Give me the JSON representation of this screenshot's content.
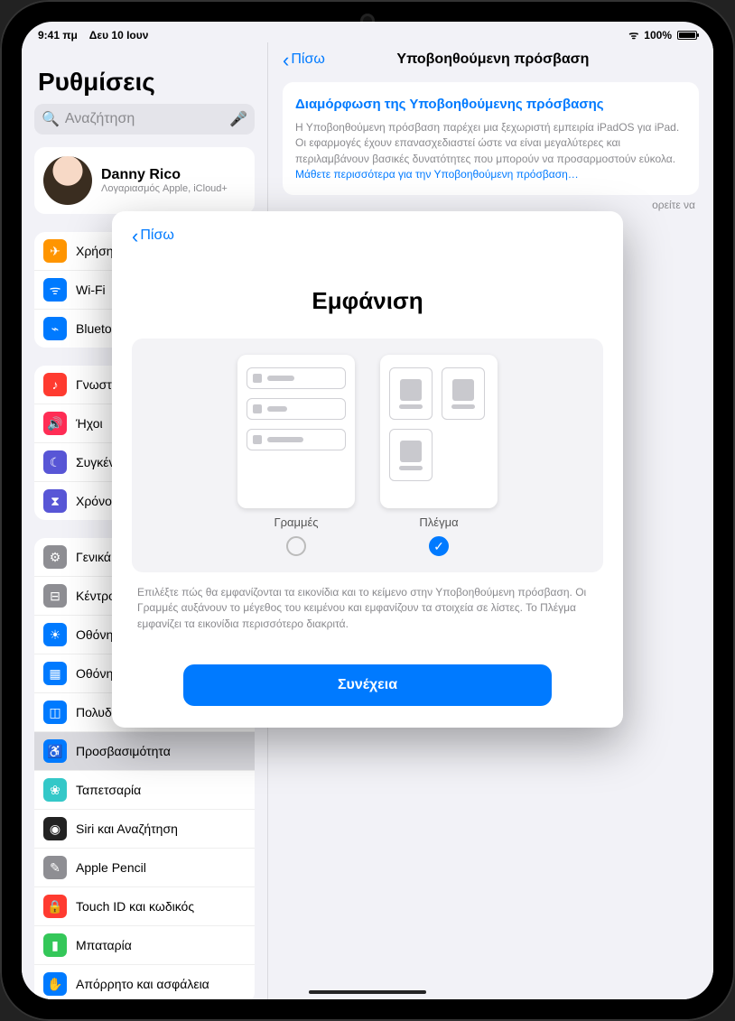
{
  "status": {
    "time": "9:41 πμ",
    "date": "Δευ 10 Ιουν",
    "battery_pct": "100%"
  },
  "sidebar": {
    "title": "Ρυθμίσεις",
    "search_placeholder": "Αναζήτηση",
    "account": {
      "name": "Danny Rico",
      "sub": "Λογαριασμός Apple, iCloud+"
    },
    "groups": [
      {
        "items": [
          {
            "label": "Χρήση σε πτήση",
            "color": "#ff9500",
            "glyph": "✈"
          },
          {
            "label": "Wi-Fi",
            "color": "#007aff",
            "glyph": "ᯤ"
          },
          {
            "label": "Bluetooth",
            "color": "#007aff",
            "glyph": "⌁"
          }
        ]
      },
      {
        "items": [
          {
            "label": "Γνωστοποιήσεις",
            "color": "#ff3b30",
            "glyph": "♪"
          },
          {
            "label": "Ήχοι",
            "color": "#ff2d55",
            "glyph": "🔊"
          },
          {
            "label": "Συγκέντρωση",
            "color": "#5856d6",
            "glyph": "☾"
          },
          {
            "label": "Χρόνος επί οθόνης",
            "color": "#5856d6",
            "glyph": "⧗"
          }
        ]
      },
      {
        "items": [
          {
            "label": "Γενικά",
            "color": "#8e8e93",
            "glyph": "⚙"
          },
          {
            "label": "Κέντρο ελέγχου",
            "color": "#8e8e93",
            "glyph": "⊟"
          },
          {
            "label": "Οθόνη και φωτεινότητα",
            "color": "#007aff",
            "glyph": "☀"
          },
          {
            "label": "Οθόνη Αφετηρίας",
            "color": "#007aff",
            "glyph": "▦"
          },
          {
            "label": "Πολυδιεργασία",
            "color": "#007aff",
            "glyph": "◫"
          },
          {
            "label": "Προσβασιμότητα",
            "color": "#007aff",
            "glyph": "♿",
            "selected": true
          },
          {
            "label": "Ταπετσαρία",
            "color": "#34c8c8",
            "glyph": "❀"
          },
          {
            "label": "Siri και Αναζήτηση",
            "color": "#222",
            "glyph": "◉"
          },
          {
            "label": "Apple Pencil",
            "color": "#8e8e93",
            "glyph": "✎"
          },
          {
            "label": "Touch ID και κωδικός",
            "color": "#ff3b30",
            "glyph": "🔒"
          },
          {
            "label": "Μπαταρία",
            "color": "#34c759",
            "glyph": "▮"
          },
          {
            "label": "Απόρρητο και ασφάλεια",
            "color": "#007aff",
            "glyph": "✋"
          }
        ]
      }
    ]
  },
  "detail": {
    "back": "Πίσω",
    "title": "Υποβοηθούμενη πρόσβαση",
    "box_title": "Διαμόρφωση της Υποβοηθούμενης πρόσβασης",
    "box_body": "Η Υποβοηθούμενη πρόσβαση παρέχει μια ξεχωριστή εμπειρία iPadOS για iPad. Οι εφαρμογές έχουν επανασχεδιαστεί ώστε να είναι μεγαλύτερες και περιλαμβάνουν βασικές δυνατότητες που μπορούν να προσαρμοστούν εύκολα. ",
    "box_link": "Μάθετε περισσότερα για την Υποβοηθούμενη πρόσβαση…",
    "box_trail": "ορείτε να"
  },
  "modal": {
    "back": "Πίσω",
    "heading": "Εμφάνιση",
    "option_rows": "Γραμμές",
    "option_grid": "Πλέγμα",
    "selected": "grid",
    "help": "Επιλέξτε πώς θα εμφανίζονται τα εικονίδια και το κείμενο στην Υποβοηθούμενη πρόσβαση. Οι Γραμμές αυξάνουν το μέγεθος του κειμένου και εμφανίζουν τα στοιχεία σε λίστες. Το Πλέγμα εμφανίζει τα εικονίδια περισσότερο διακριτά.",
    "continue": "Συνέχεια"
  }
}
